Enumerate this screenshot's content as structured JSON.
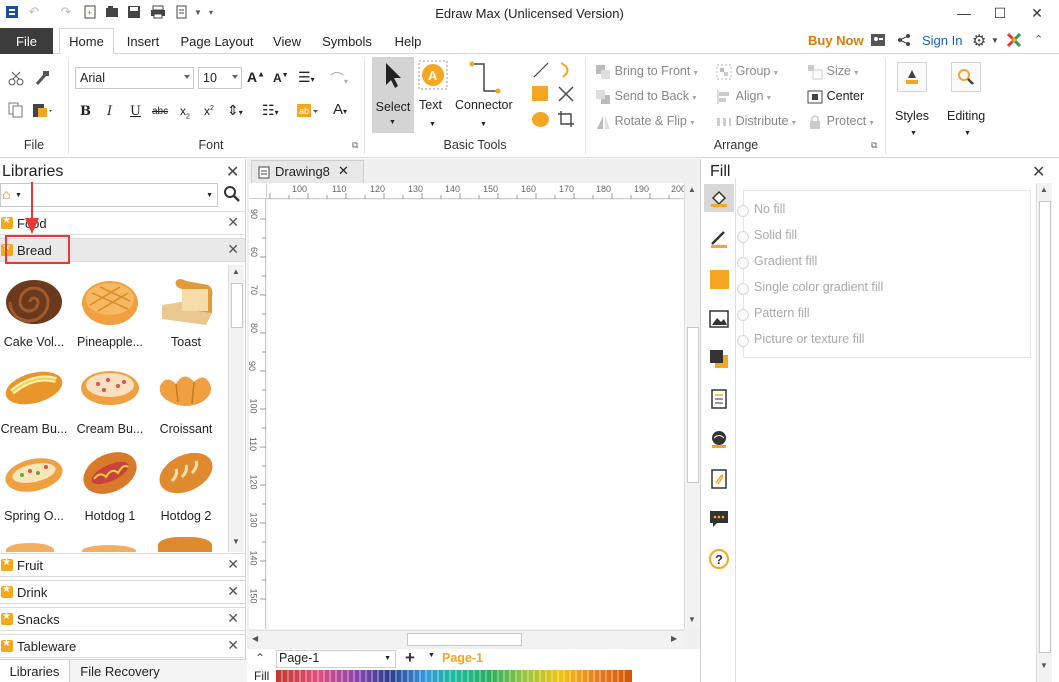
{
  "window": {
    "title": "Edraw Max (Unlicensed Version)"
  },
  "menu": {
    "file": "File",
    "tabs": [
      "Home",
      "Insert",
      "Page Layout",
      "View",
      "Symbols",
      "Help"
    ],
    "buy_now": "Buy Now",
    "sign_in": "Sign In"
  },
  "ribbon": {
    "file_group": "File",
    "font_group": "Font",
    "font_name": "Arial",
    "font_size": "10",
    "basic_tools_group": "Basic Tools",
    "select": "Select",
    "text": "Text",
    "connector": "Connector",
    "arrange_group": "Arrange",
    "bring_to_front": "Bring to Front",
    "send_to_back": "Send to Back",
    "rotate_flip": "Rotate & Flip",
    "group": "Group",
    "align": "Align",
    "distribute": "Distribute",
    "size": "Size",
    "center": "Center",
    "protect": "Protect",
    "styles": "Styles",
    "editing": "Editing"
  },
  "libraries": {
    "title": "Libraries",
    "categories_top": [
      "Food",
      "Bread"
    ],
    "shapes": [
      {
        "label": "Cake Vol...",
        "icon": "cake-roll"
      },
      {
        "label": "Pineapple...",
        "icon": "pineapple-bun"
      },
      {
        "label": "Toast",
        "icon": "toast"
      },
      {
        "label": "Cream Bu...",
        "icon": "cream-bun-1"
      },
      {
        "label": "Cream Bu...",
        "icon": "cream-bun-2"
      },
      {
        "label": "Croissant",
        "icon": "croissant"
      },
      {
        "label": "Spring O...",
        "icon": "spring-onion-bread"
      },
      {
        "label": "Hotdog 1",
        "icon": "hotdog-1"
      },
      {
        "label": "Hotdog 2",
        "icon": "hotdog-2"
      }
    ],
    "categories_bottom": [
      "Fruit",
      "Drink",
      "Snacks",
      "Tableware"
    ]
  },
  "canvas": {
    "doc_tab": "Drawing8",
    "ruler_h": [
      "100",
      "110",
      "120",
      "130",
      "140",
      "150",
      "160",
      "170",
      "180",
      "190",
      "200"
    ],
    "ruler_v": [
      "90",
      "60",
      "70",
      "80",
      "90",
      "100",
      "110",
      "120",
      "130",
      "140",
      "150"
    ]
  },
  "fill": {
    "title": "Fill",
    "options": [
      "No fill",
      "Solid fill",
      "Gradient fill",
      "Single color gradient fill",
      "Pattern fill",
      "Picture or texture fill"
    ]
  },
  "bottom": {
    "libraries_tab": "Libraries",
    "file_recovery_tab": "File Recovery",
    "page_select": "Page-1",
    "page_tab": "Page-1",
    "fill_label": "Fill"
  },
  "colors": {
    "accent": "#f5a623",
    "buy_now": "#e07b00",
    "sign_in": "#1a5fb4",
    "file_tab": "#3c3c3c",
    "highlight_box": "#e53935"
  }
}
